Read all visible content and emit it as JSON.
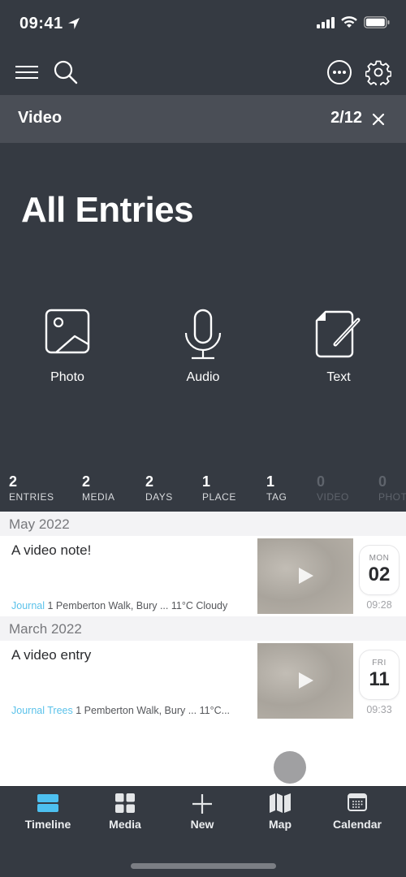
{
  "status_bar": {
    "time": "09:41"
  },
  "toolbar": {
    "menu_icon": "hamburger-icon",
    "search_icon": "search-icon",
    "more_icon": "ellipsis-circle-icon",
    "settings_icon": "gear-icon"
  },
  "filter": {
    "label": "Video",
    "count": "2/12"
  },
  "page": {
    "title": "All Entries"
  },
  "quick_actions": [
    {
      "label": "Photo",
      "icon": "photo-icon"
    },
    {
      "label": "Audio",
      "icon": "microphone-icon"
    },
    {
      "label": "Text",
      "icon": "text-edit-icon"
    }
  ],
  "stats": [
    {
      "value": "2",
      "label": "ENTRIES"
    },
    {
      "value": "2",
      "label": "MEDIA"
    },
    {
      "value": "2",
      "label": "DAYS"
    },
    {
      "value": "1",
      "label": "PLACE"
    },
    {
      "value": "1",
      "label": "TAG"
    },
    {
      "value": "0",
      "label": "VIDEO"
    },
    {
      "value": "0",
      "label": "PHOT"
    }
  ],
  "sections": [
    {
      "header": "May 2022",
      "entries": [
        {
          "title": "A video note!",
          "tags": [
            "Journal"
          ],
          "meta": "1 Pemberton Walk, Bury ... 11°C Cloudy",
          "dow": "MON",
          "day": "02",
          "time": "09:28"
        }
      ]
    },
    {
      "header": "March 2022",
      "entries": [
        {
          "title": "A video entry",
          "tags": [
            "Journal",
            "Trees"
          ],
          "meta": "1 Pemberton Walk, Bury ... 11°C...",
          "dow": "FRI",
          "day": "11",
          "time": "09:33"
        }
      ]
    }
  ],
  "tabs": [
    {
      "label": "Timeline",
      "icon": "timeline-icon",
      "active": true
    },
    {
      "label": "Media",
      "icon": "grid-icon"
    },
    {
      "label": "New",
      "icon": "plus-icon"
    },
    {
      "label": "Map",
      "icon": "map-icon"
    },
    {
      "label": "Calendar",
      "icon": "calendar-icon"
    }
  ],
  "colors": {
    "accent": "#4dc0f0",
    "background": "#353a42",
    "filter_bar": "#4a4e56",
    "tag": "#5bc2ea"
  }
}
